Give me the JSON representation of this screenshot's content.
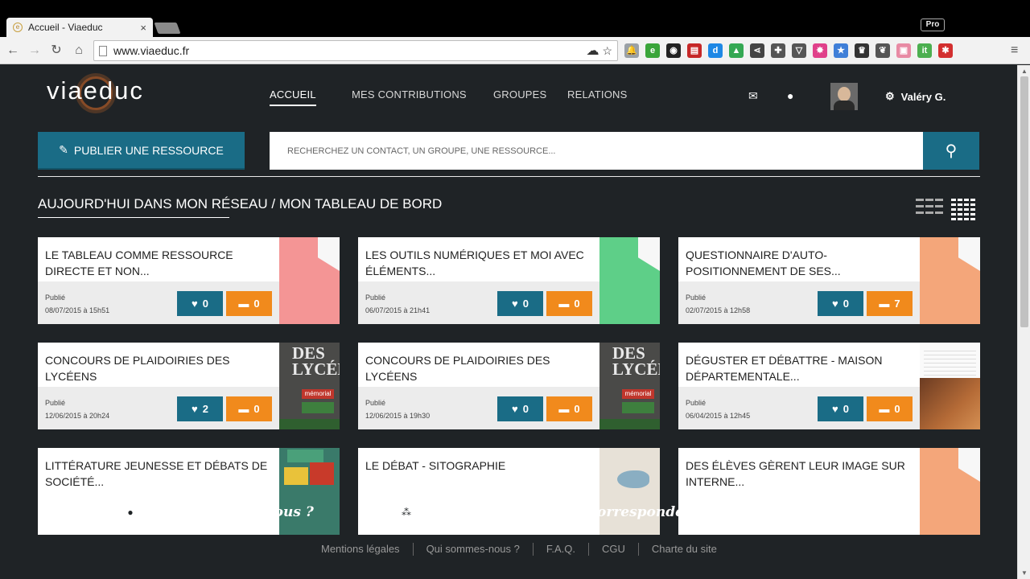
{
  "browser": {
    "tab_title": "Accueil - Viaeduc",
    "tab_close": "×",
    "profile_badge": "Pro",
    "url": "www.viaeduc.fr",
    "extensions": [
      {
        "icon": "bell-icon",
        "color": "#9aa0a6",
        "glyph": "🔔"
      },
      {
        "icon": "evernote-icon",
        "color": "#3aa53a",
        "glyph": "e"
      },
      {
        "icon": "disc-icon",
        "color": "#222222",
        "glyph": "◉"
      },
      {
        "icon": "film-icon",
        "color": "#c62828",
        "glyph": "▤"
      },
      {
        "icon": "d-icon",
        "color": "#1e88e5",
        "glyph": "d"
      },
      {
        "icon": "drive-icon",
        "color": "#34a853",
        "glyph": "▲"
      },
      {
        "icon": "share-icon",
        "color": "#444444",
        "glyph": "⋖"
      },
      {
        "icon": "puzzle-icon",
        "color": "#555555",
        "glyph": "✚"
      },
      {
        "icon": "pocket-icon",
        "color": "#555555",
        "glyph": "▽"
      },
      {
        "icon": "color-wheel-icon",
        "color": "#e0408a",
        "glyph": "✸"
      },
      {
        "icon": "star-badge-icon",
        "color": "#3f7fd8",
        "glyph": "★"
      },
      {
        "icon": "crown-icon",
        "color": "#333333",
        "glyph": "♛"
      },
      {
        "icon": "leaf-icon",
        "color": "#555555",
        "glyph": "❦"
      },
      {
        "icon": "chat-icon",
        "color": "#e88aa4",
        "glyph": "▣"
      },
      {
        "icon": "it-icon",
        "color": "#4caf50",
        "glyph": "it"
      },
      {
        "icon": "plugin-icon",
        "color": "#d32f2f",
        "glyph": "✱"
      }
    ]
  },
  "site": {
    "logo": "viaeduc",
    "nav": [
      {
        "label": "ACCUEIL",
        "active": true
      },
      {
        "label": "MES CONTRIBUTIONS",
        "active": false
      },
      {
        "label": "GROUPES",
        "active": false
      },
      {
        "label": "RELATIONS",
        "active": false
      }
    ],
    "user_name": "Valéry G.",
    "publish_label": "PUBLIER UNE RESSOURCE",
    "search_placeholder": "RECHERCHEZ UN CONTACT, UN GROUPE, UNE RESSOURCE...",
    "section_title": "AUJOURD'HUI DANS MON RÉSEAU / MON TABLEAU DE BORD"
  },
  "cards": [
    {
      "title": "LE TABLEAU COMME RESSOURCE DIRECTE ET NON...",
      "status": "Publié",
      "date": "08/07/2015 à 15h51",
      "likes": "0",
      "comments": "0",
      "thumb": "pink"
    },
    {
      "title": "LES OUTILS NUMÉRIQUES ET MOI AVEC ÉLÉMENTS...",
      "status": "Publié",
      "date": "06/07/2015 à 21h41",
      "likes": "0",
      "comments": "0",
      "thumb": "green"
    },
    {
      "title": "QUESTIONNAIRE D'AUTO-POSITIONNEMENT DE SES...",
      "status": "Publié",
      "date": "02/07/2015 à 12h58",
      "likes": "0",
      "comments": "7",
      "thumb": "orange"
    },
    {
      "title": "CONCOURS DE PLAIDOIRIES DES LYCÉENS",
      "status": "Publié",
      "date": "12/06/2015 à 20h24",
      "likes": "2",
      "comments": "0",
      "thumb": "book",
      "thumb_text": "DES LYCÉE",
      "thumb_label": "mémorial"
    },
    {
      "title": "CONCOURS DE PLAIDOIRIES DES LYCÉENS",
      "status": "Publié",
      "date": "12/06/2015 à 19h30",
      "likes": "0",
      "comments": "0",
      "thumb": "book",
      "thumb_text": "DES LYCÉE",
      "thumb_label": "mémorial"
    },
    {
      "title": "DÉGUSTER ET DÉBATTRE - MAISON DÉPARTEMENTALE...",
      "status": "Publié",
      "date": "06/04/2015 à 12h45",
      "likes": "0",
      "comments": "0",
      "thumb": "doc"
    },
    {
      "title": "LITTÉRATURE JEUNESSE ET DÉBATS DE SOCIÉTÉ...",
      "thumb": "toys"
    },
    {
      "title": "LE DÉBAT - SITOGRAPHIE",
      "thumb": "bird"
    },
    {
      "title": "DES ÉLÈVES GÈRENT LEUR IMAGE SUR INTERNE...",
      "thumb": "orange"
    }
  ],
  "footer": {
    "cta_people": "Les connaissez-vous ?",
    "cta_groups": "Les groupes qui vous correspondent",
    "links": [
      "Mentions légales",
      "Qui sommes-nous ?",
      "F.A.Q.",
      "CGU",
      "Charte du site"
    ]
  }
}
